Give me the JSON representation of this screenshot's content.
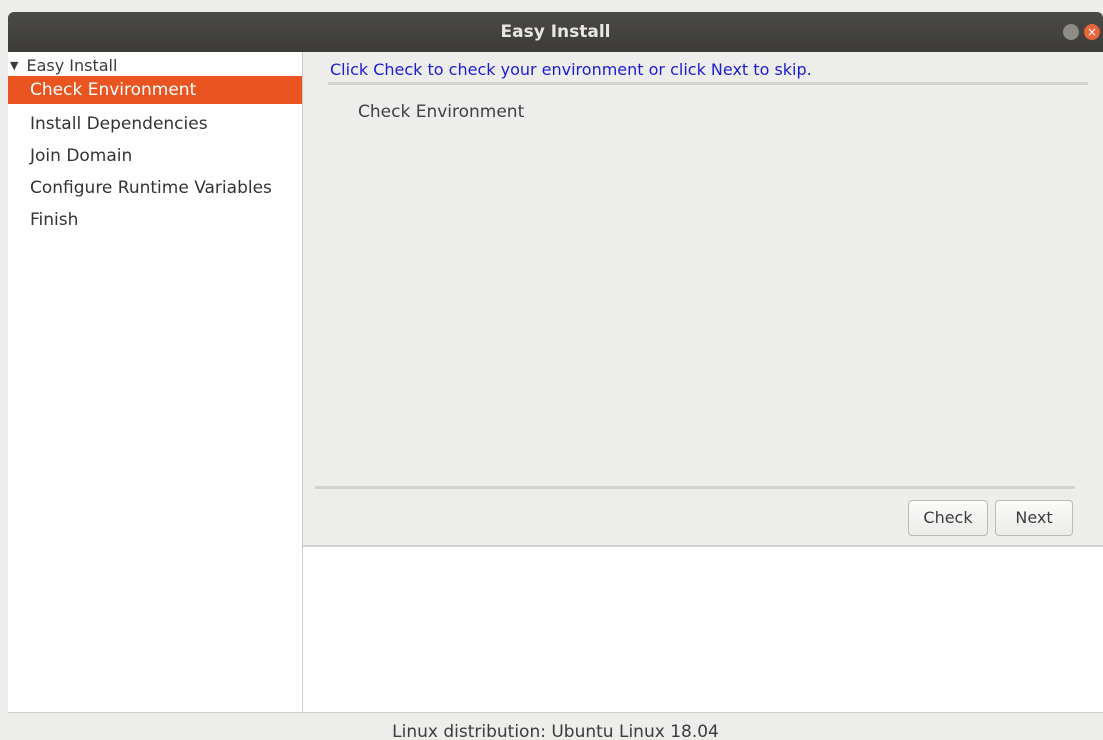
{
  "window": {
    "title": "Easy Install"
  },
  "sidebar": {
    "root_label": "Easy Install",
    "items": [
      {
        "label": "Check Environment",
        "selected": true
      },
      {
        "label": "Install Dependencies",
        "selected": false
      },
      {
        "label": "Join Domain",
        "selected": false
      },
      {
        "label": "Configure Runtime Variables",
        "selected": false
      },
      {
        "label": "Finish",
        "selected": false
      }
    ]
  },
  "main": {
    "instruction": "Click Check to check your environment or click Next to skip.",
    "section_label": "Check Environment",
    "buttons": {
      "check_label": "Check",
      "next_label": "Next"
    }
  },
  "status_bar": {
    "text": "Linux distribution: Ubuntu Linux 18.04"
  },
  "colors": {
    "selection": "#e95420",
    "instruction_text": "#1c1cd6",
    "titlebar": "#3c3b37"
  }
}
